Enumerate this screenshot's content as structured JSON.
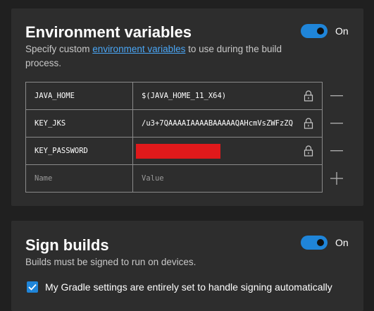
{
  "env_section": {
    "title": "Environment variables",
    "description_prefix": "Specify custom ",
    "description_link": "environment variables",
    "description_suffix": " to use during the build process.",
    "toggle_label": "On",
    "toggle_on": true,
    "rows": [
      {
        "name": "JAVA_HOME",
        "value": "$(JAVA_HOME_11_X64)",
        "redacted": false,
        "action": "remove"
      },
      {
        "name": "KEY_JKS",
        "value": "/u3+7QAAAAIAAAABAAAAAQAHcmVsZWFzZQ",
        "redacted": false,
        "action": "remove"
      },
      {
        "name": "KEY_PASSWORD",
        "value": "",
        "redacted": true,
        "action": "remove"
      }
    ],
    "new_row": {
      "name_placeholder": "Name",
      "value_placeholder": "Value",
      "action": "add"
    }
  },
  "sign_section": {
    "title": "Sign builds",
    "description": "Builds must be signed to run on devices.",
    "toggle_label": "On",
    "toggle_on": true,
    "checkbox_label": "My Gradle settings are entirely set to handle signing automatically",
    "checkbox_checked": true
  },
  "colors": {
    "accent": "#1f85d9",
    "link": "#4aa6f5",
    "redaction": "#e0191b"
  }
}
